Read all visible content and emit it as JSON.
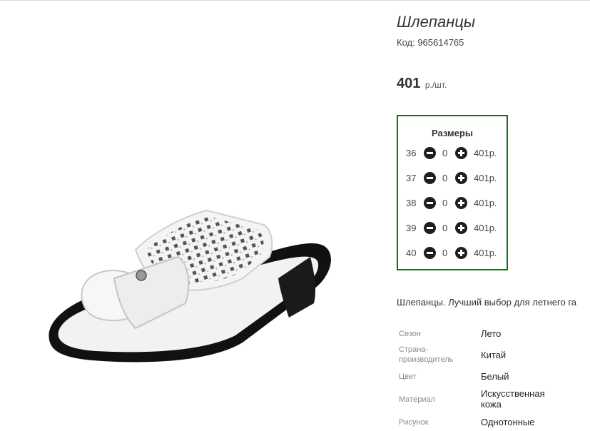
{
  "product": {
    "title": "Шлепанцы",
    "code": "Код: 965614765",
    "price_value": "401",
    "price_unit": "р./шт."
  },
  "sizes": {
    "title": "Размеры",
    "rows": [
      {
        "size": "36",
        "qty": "0",
        "price": "401р."
      },
      {
        "size": "37",
        "qty": "0",
        "price": "401р."
      },
      {
        "size": "38",
        "qty": "0",
        "price": "401р."
      },
      {
        "size": "39",
        "qty": "0",
        "price": "401р."
      },
      {
        "size": "40",
        "qty": "0",
        "price": "401р."
      }
    ]
  },
  "description": "Шлепанцы. Лучший выбор для летнего га",
  "properties": [
    {
      "label": "Сезон",
      "value": "Лето"
    },
    {
      "label": "Страна-производитель",
      "value": "Китай"
    },
    {
      "label": "Цвет",
      "value": "Белый"
    },
    {
      "label": "Материал",
      "value": "Искусственная кожа"
    },
    {
      "label": "Рисунок",
      "value": "Однотонные"
    }
  ],
  "icons": {
    "minus": "minus-circle-icon",
    "plus": "plus-circle-icon"
  },
  "colors": {
    "accent_border": "#0a7a0a",
    "button": "#1e1e1e"
  }
}
